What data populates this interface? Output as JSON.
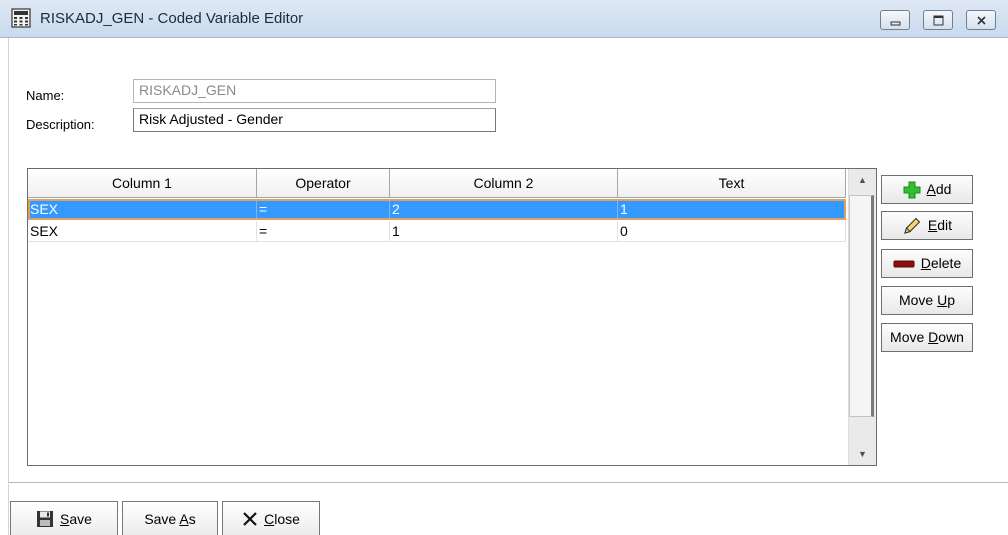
{
  "window": {
    "title": "RISKADJ_GEN - Coded Variable Editor",
    "app_icon": "calculator-icon"
  },
  "form": {
    "name_label": "Name:",
    "name_value": "RISKADJ_GEN",
    "description_label": "Description:",
    "description_value": "Risk Adjusted - Gender"
  },
  "grid": {
    "columns": [
      "Column 1",
      "Operator",
      "Column 2",
      "Text"
    ],
    "rows": [
      [
        "SEX",
        "=",
        "2",
        "1"
      ],
      [
        "SEX",
        "=",
        "1",
        "0"
      ]
    ],
    "selected_row": 0
  },
  "side_buttons": {
    "add": {
      "pre": "",
      "key": "A",
      "post": "dd",
      "icon": "plus-icon"
    },
    "edit": {
      "pre": "",
      "key": "E",
      "post": "dit",
      "icon": "pencil-icon"
    },
    "delete": {
      "pre": "",
      "key": "D",
      "post": "elete",
      "icon": "minus-icon"
    },
    "move_up": {
      "pre": "Move ",
      "key": "U",
      "post": "p"
    },
    "move_down": {
      "pre": "Move ",
      "key": "D",
      "post": "own"
    }
  },
  "bottom_buttons": {
    "save": {
      "pre": "",
      "key": "S",
      "post": "ave",
      "icon": "floppy-disk-icon"
    },
    "save_as": {
      "pre": "Save ",
      "key": "A",
      "post": "s"
    },
    "close": {
      "pre": "",
      "key": "C",
      "post": "lose",
      "icon": "close-x-icon"
    }
  },
  "colors": {
    "selection": "#3399ff",
    "add_icon": "#2fbf2f",
    "delete_icon": "#8b0f0f"
  }
}
